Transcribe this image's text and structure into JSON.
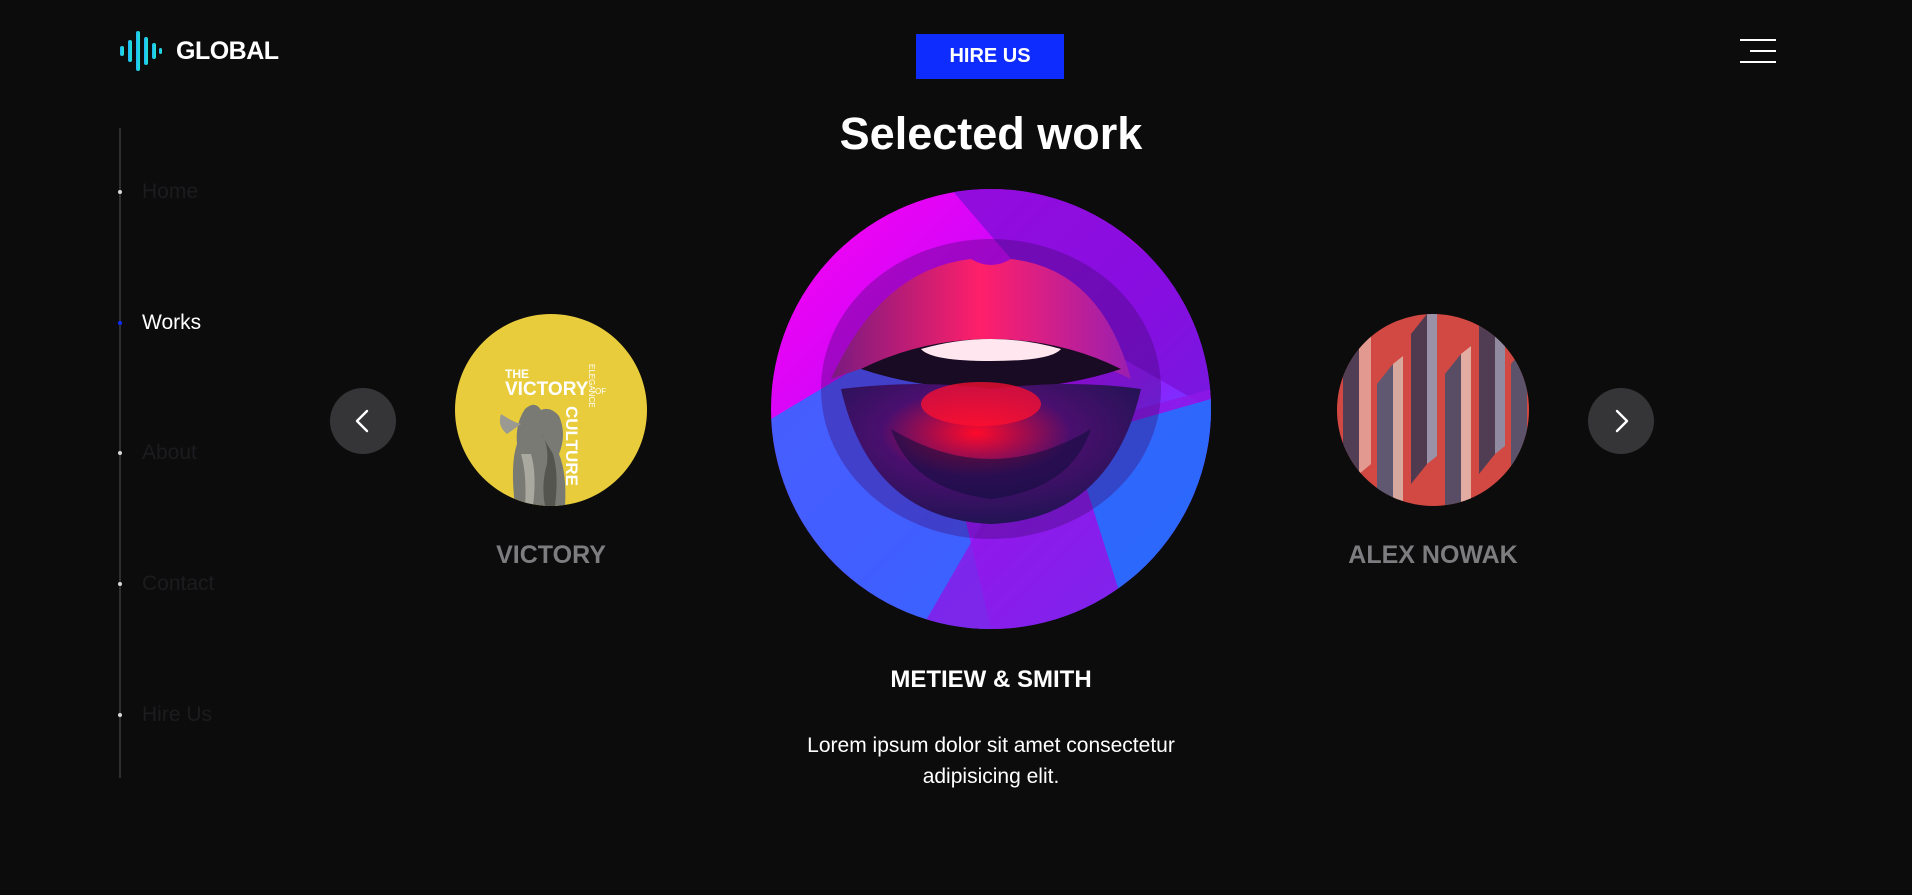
{
  "brand": {
    "name": "GLOBAL"
  },
  "header": {
    "hire_label": "HIRE US",
    "menu_icon": "hamburger-icon"
  },
  "side_nav": {
    "items": [
      {
        "label": "Home",
        "active": false
      },
      {
        "label": "Works",
        "active": true
      },
      {
        "label": "About",
        "active": false
      },
      {
        "label": "Contact",
        "active": false
      },
      {
        "label": "Hire Us",
        "active": false
      }
    ]
  },
  "section": {
    "title": "Selected work"
  },
  "carousel": {
    "prev_icon": "chevron-left-icon",
    "next_icon": "chevron-right-icon",
    "left": {
      "name": "VICTORY",
      "poster": {
        "line1": "THE",
        "line2": "VICTORY",
        "line3": "OF",
        "line4": "CULTURE",
        "side": "ELEGANCE"
      }
    },
    "center": {
      "name": "METIEW & SMITH",
      "description": "Lorem ipsum dolor sit amet consectetur adipisicing elit."
    },
    "right": {
      "name": "ALEX NOWAK"
    }
  },
  "colors": {
    "accent": "#0f2cff",
    "background": "#0c0c0d",
    "muted_text": "#7d7d80"
  }
}
